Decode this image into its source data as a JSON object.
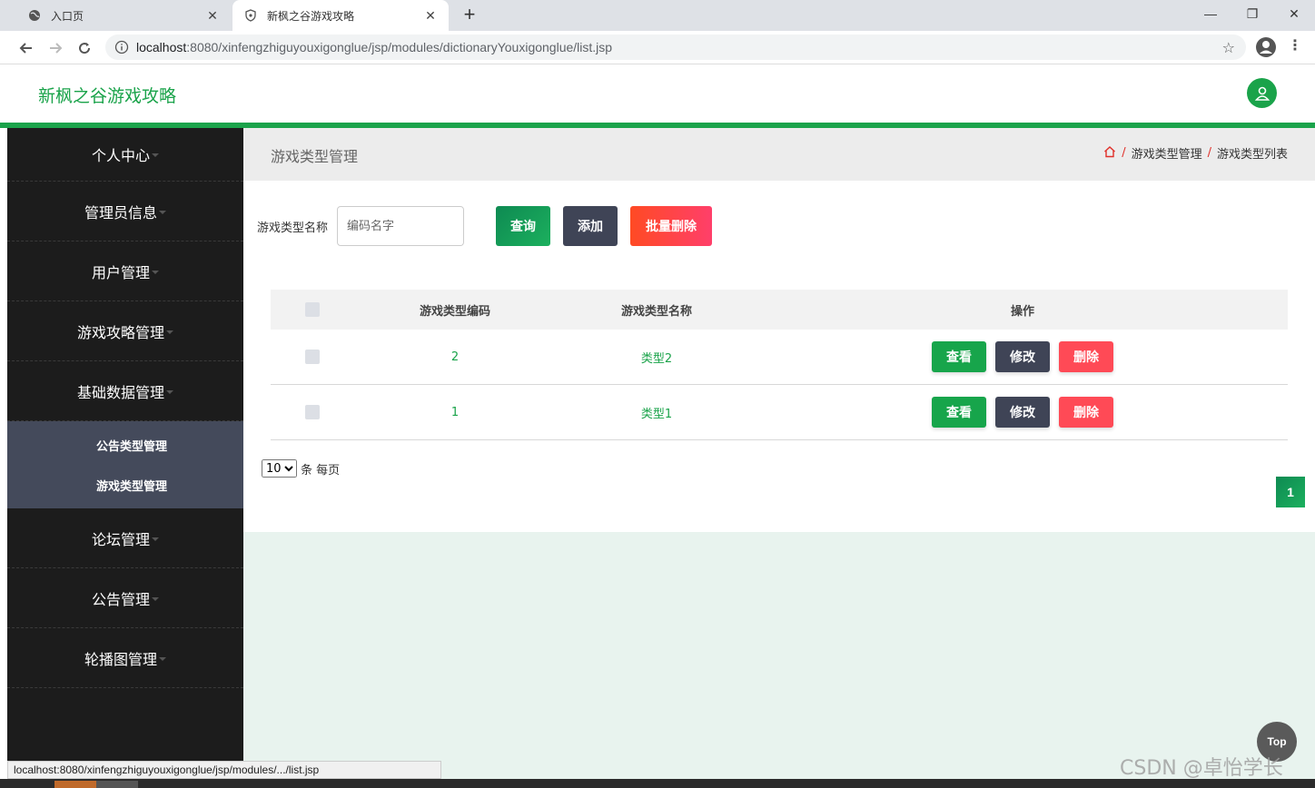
{
  "browser": {
    "tabs": [
      {
        "title": "入口页",
        "active": false
      },
      {
        "title": "新枫之谷游戏攻略",
        "active": true
      }
    ],
    "url_host": "localhost",
    "url_path": ":8080/xinfengzhiguyouxigonglue/jsp/modules/dictionaryYouxigonglue/list.jsp",
    "status_url": "localhost:8080/xinfengzhiguyouxigonglue/jsp/modules/.../list.jsp"
  },
  "header": {
    "title": "新枫之谷游戏攻略"
  },
  "sidebar": {
    "items": [
      {
        "label": "个人中心"
      },
      {
        "label": "管理员信息"
      },
      {
        "label": "用户管理"
      },
      {
        "label": "游戏攻略管理"
      },
      {
        "label": "基础数据管理"
      }
    ],
    "submenu": [
      {
        "label": "公告类型管理"
      },
      {
        "label": "游戏类型管理"
      }
    ],
    "items_after": [
      {
        "label": "论坛管理"
      },
      {
        "label": "公告管理"
      },
      {
        "label": "轮播图管理"
      }
    ]
  },
  "page": {
    "title": "游戏类型管理",
    "breadcrumb": [
      "游戏类型管理",
      "游戏类型列表"
    ]
  },
  "search": {
    "label": "游戏类型名称",
    "placeholder": "编码名字",
    "query_label": "查询",
    "add_label": "添加",
    "batch_delete_label": "批量删除"
  },
  "table": {
    "headers": {
      "code": "游戏类型编码",
      "name": "游戏类型名称",
      "ops": "操作"
    },
    "rows": [
      {
        "code": "2",
        "name": "类型2"
      },
      {
        "code": "1",
        "name": "类型1"
      }
    ],
    "ops": {
      "view": "查看",
      "edit": "修改",
      "delete": "删除"
    }
  },
  "pagination": {
    "page_size": "10",
    "page_size_options": [
      "10"
    ],
    "suffix": "条 每页",
    "current_page": "1"
  },
  "top_button": "Top",
  "watermark": "CSDN @卓怡学长",
  "colors": {
    "brand": "#1aa34a",
    "sidebar": "#1c1c1c",
    "submenu": "#444a5b",
    "danger": "#ff4a56",
    "dark_button": "#3f4456"
  }
}
